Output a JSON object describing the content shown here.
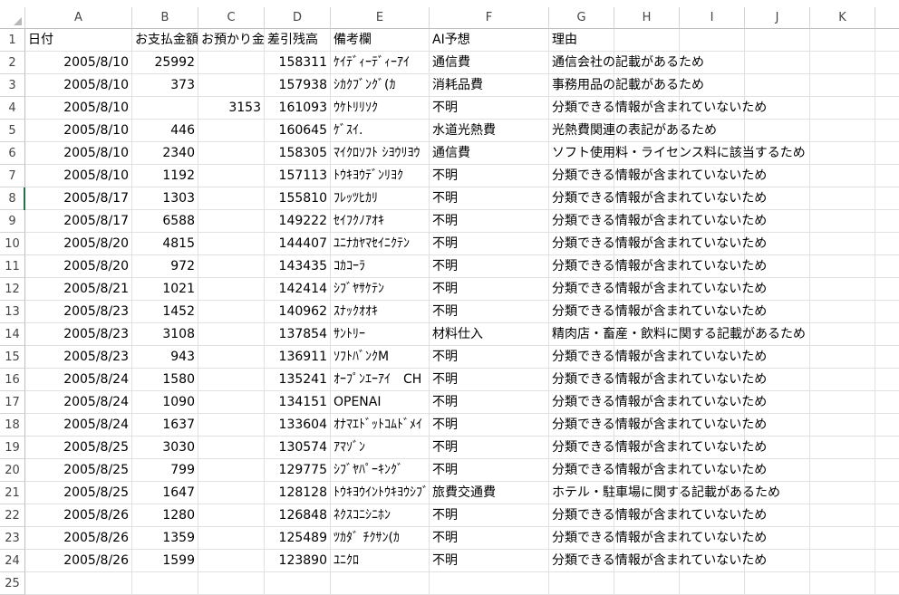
{
  "columns": [
    "A",
    "B",
    "C",
    "D",
    "E",
    "F",
    "G",
    "H",
    "I",
    "J",
    "K",
    ""
  ],
  "header_row": {
    "num": "1",
    "A": "日付",
    "B": "お支払金額",
    "C": "お預かり金額",
    "D": "差引残高",
    "E": "備考欄",
    "F": "AI予想",
    "G": "理由"
  },
  "rows": [
    {
      "num": "2",
      "A": "2005/8/10",
      "B": "25992",
      "C": "",
      "D": "158311",
      "E": "ｹｲﾃﾞｨｰﾃﾞｨｰｱｲ",
      "F": "通信費",
      "G": "通信会社の記載があるため"
    },
    {
      "num": "3",
      "A": "2005/8/10",
      "B": "373",
      "C": "",
      "D": "157938",
      "E": "ｼｶｸﾌﾞﾝｸﾞ(ｶ",
      "F": "消耗品費",
      "G": "事務用品の記載があるため"
    },
    {
      "num": "4",
      "A": "2005/8/10",
      "B": "",
      "C": "3153",
      "D": "161093",
      "E": "ｳｹﾄﾘﾘｿｸ",
      "F": "不明",
      "G": "分類できる情報が含まれていないため"
    },
    {
      "num": "5",
      "A": "2005/8/10",
      "B": "446",
      "C": "",
      "D": "160645",
      "E": "ｹﾞｽｲ.",
      "F": "水道光熱費",
      "G": "光熱費関連の表記があるため"
    },
    {
      "num": "6",
      "A": "2005/8/10",
      "B": "2340",
      "C": "",
      "D": "158305",
      "E": "ﾏｲｸﾛｿﾌﾄ ｼﾖｳﾘﾖｳ",
      "F": "通信費",
      "G": "ソフト使用料・ライセンス料に該当するため"
    },
    {
      "num": "7",
      "A": "2005/8/10",
      "B": "1192",
      "C": "",
      "D": "157113",
      "E": "ﾄｳｷﾖｳﾃﾞﾝﾘﾖｸ",
      "F": "不明",
      "G": "分類できる情報が含まれていないため"
    },
    {
      "num": "8",
      "A": "2005/8/17",
      "B": "1303",
      "C": "",
      "D": "155810",
      "E": "ﾌﾚｯﾂﾋｶﾘ",
      "F": "不明",
      "G": "分類できる情報が含まれていないため"
    },
    {
      "num": "9",
      "A": "2005/8/17",
      "B": "6588",
      "C": "",
      "D": "149222",
      "E": "ｾｲﾌｸﾉｱｵｷ",
      "F": "不明",
      "G": "分類できる情報が含まれていないため"
    },
    {
      "num": "10",
      "A": "2005/8/20",
      "B": "4815",
      "C": "",
      "D": "144407",
      "E": "ﾕﾆﾅｶﾔﾏｾｲﾆｸﾃﾝ",
      "F": "不明",
      "G": "分類できる情報が含まれていないため"
    },
    {
      "num": "11",
      "A": "2005/8/20",
      "B": "972",
      "C": "",
      "D": "143435",
      "E": "ｺｶｺｰﾗ",
      "F": "不明",
      "G": "分類できる情報が含まれていないため"
    },
    {
      "num": "12",
      "A": "2005/8/21",
      "B": "1021",
      "C": "",
      "D": "142414",
      "E": "ｼﾌﾞﾔｻｹﾃﾝ",
      "F": "不明",
      "G": "分類できる情報が含まれていないため"
    },
    {
      "num": "13",
      "A": "2005/8/23",
      "B": "1452",
      "C": "",
      "D": "140962",
      "E": "ｽﾅｯｸｵｵｷ",
      "F": "不明",
      "G": "分類できる情報が含まれていないため"
    },
    {
      "num": "14",
      "A": "2005/8/23",
      "B": "3108",
      "C": "",
      "D": "137854",
      "E": "ｻﾝﾄﾘｰ",
      "F": "材料仕入",
      "G": "精肉店・畜産・飲料に関する記載があるため"
    },
    {
      "num": "15",
      "A": "2005/8/23",
      "B": "943",
      "C": "",
      "D": "136911",
      "E": "ｿﾌﾄﾊﾞﾝｸM",
      "F": "不明",
      "G": "分類できる情報が含まれていないため"
    },
    {
      "num": "16",
      "A": "2005/8/24",
      "B": "1580",
      "C": "",
      "D": "135241",
      "E": "ｵｰﾌﾟﾝｴｰｱｲ　CH",
      "F": "不明",
      "G": "分類できる情報が含まれていないため"
    },
    {
      "num": "17",
      "A": "2005/8/24",
      "B": "1090",
      "C": "",
      "D": "134151",
      "E": "OPENAI",
      "F": "不明",
      "G": "分類できる情報が含まれていないため"
    },
    {
      "num": "18",
      "A": "2005/8/24",
      "B": "1637",
      "C": "",
      "D": "133604",
      "E": "ｵﾅﾏｴﾄﾞｯﾄｺﾑﾄﾞﾒｲ",
      "F": "不明",
      "G": "分類できる情報が含まれていないため"
    },
    {
      "num": "19",
      "A": "2005/8/25",
      "B": "3030",
      "C": "",
      "D": "130574",
      "E": "ｱﾏｿﾞﾝ",
      "F": "不明",
      "G": "分類できる情報が含まれていないため"
    },
    {
      "num": "20",
      "A": "2005/8/25",
      "B": "799",
      "C": "",
      "D": "129775",
      "E": "ｼﾌﾞﾔﾊﾟｰｷﾝｸﾞ",
      "F": "不明",
      "G": "分類できる情報が含まれていないため"
    },
    {
      "num": "21",
      "A": "2005/8/25",
      "B": "1647",
      "C": "",
      "D": "128128",
      "E": "ﾄｳｷﾖｳｲﾝﾄｳｷﾖｳｼﾌﾞﾔ",
      "F": "旅費交通費",
      "G": "ホテル・駐車場に関する記載があるため"
    },
    {
      "num": "22",
      "A": "2005/8/26",
      "B": "1280",
      "C": "",
      "D": "126848",
      "E": "ﾈｸｽｺﾆｼﾆﾎﾝ",
      "F": "不明",
      "G": "分類できる情報が含まれていないため"
    },
    {
      "num": "23",
      "A": "2005/8/26",
      "B": "1359",
      "C": "",
      "D": "125489",
      "E": "ﾂｶﾀﾞ ﾁｸｻﾝ(ｶ",
      "F": "不明",
      "G": "分類できる情報が含まれていないため"
    },
    {
      "num": "24",
      "A": "2005/8/26",
      "B": "1599",
      "C": "",
      "D": "123890",
      "E": "ﾕﾆｸﾛ",
      "F": "不明",
      "G": "分類できる情報が含まれていないため"
    }
  ],
  "empty_row": {
    "num": "25"
  }
}
